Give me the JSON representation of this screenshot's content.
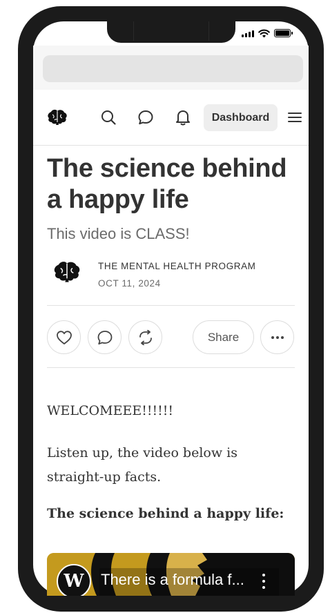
{
  "status_bar": {
    "signal_icon": "signal-bars-icon",
    "wifi_icon": "wifi-icon",
    "battery_icon": "battery-icon"
  },
  "nav": {
    "logo_icon": "brain-logo-icon",
    "search_icon": "search-icon",
    "chat_icon": "chat-bubble-icon",
    "notifications_icon": "bell-icon",
    "dashboard_label": "Dashboard",
    "menu_icon": "hamburger-menu-icon"
  },
  "post": {
    "title": "The science behind a happy life",
    "subtitle": "This video is CLASS!",
    "author": "THE MENTAL HEALTH PROGRAM",
    "date": "OCT 11, 2024"
  },
  "actions": {
    "like_icon": "heart-icon",
    "comment_icon": "comment-icon",
    "restack_icon": "restack-icon",
    "share_label": "Share",
    "more_icon": "more-dots-icon"
  },
  "content": {
    "paragraph_1": "WELCOMEEE!!!!!!",
    "paragraph_2": "Listen up, the video below is straight-up facts.",
    "heading": "The science behind a happy life:"
  },
  "video": {
    "channel_letter": "W",
    "title": "There is a formula f...",
    "menu_icon": "vertical-dots-icon"
  },
  "colors": {
    "frame": "#1b1b1b",
    "text_primary": "#333333",
    "text_secondary": "#6b6b6b",
    "dashboard_bg": "#eeeeee",
    "video_gold": "#c49a1e"
  }
}
